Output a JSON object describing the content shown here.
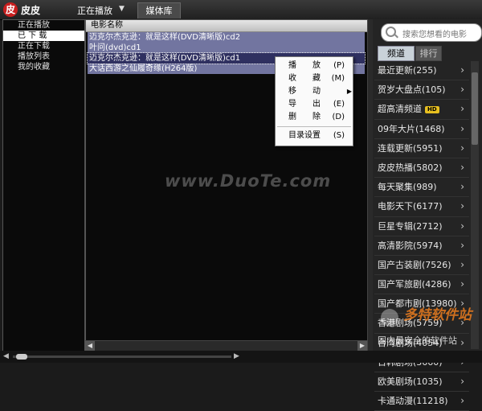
{
  "app": {
    "logo_glyph": "皮",
    "title": "皮皮"
  },
  "top_tabs": {
    "now_playing": "正在播放",
    "library": "媒体库"
  },
  "left_nav": {
    "items": [
      "正在播放",
      "已 下 载",
      "正在下载",
      "播放列表",
      "我的收藏"
    ],
    "selected_index": 1
  },
  "file_list": {
    "column_header": "电影名称",
    "rows": [
      {
        "name": "迈克尔杰克逊：就是这样(DVD清晰版)cd2",
        "state": "highlighted"
      },
      {
        "name": "叶问(dvd)cd1",
        "state": "highlighted"
      },
      {
        "name": "迈克尔杰克逊：就是这样(DVD清晰版)cd1",
        "state": "selected"
      },
      {
        "name": "大话西游之仙履奇缘(H264版)",
        "state": "highlighted"
      }
    ]
  },
  "context_menu": {
    "items": [
      {
        "label": "播　　放",
        "key": "(P)"
      },
      {
        "label": "收　　藏",
        "key": "(M)"
      },
      {
        "label": "移　　动",
        "key": ""
      },
      {
        "label": "导　　出",
        "key": "(E)"
      },
      {
        "label": "删　　除",
        "key": "(D)"
      },
      {
        "label": "目录设置",
        "key": "(S)"
      }
    ]
  },
  "watermark": "www.DuoTe.com",
  "search": {
    "placeholder": "搜索您想看的电影"
  },
  "right_tabs": {
    "channels": "频道",
    "ranking": "排行"
  },
  "channels": [
    {
      "label": "最近更新(255)"
    },
    {
      "label": "贺岁大盘点(105)"
    },
    {
      "label": "超高清频道",
      "badge": "HD"
    },
    {
      "label": "09年大片(1468)"
    },
    {
      "label": "连载更新(5951)"
    },
    {
      "label": "皮皮热播(5802)"
    },
    {
      "label": "每天聚集(989)"
    },
    {
      "label": "电影天下(6177)"
    },
    {
      "label": "巨星专辑(2712)"
    },
    {
      "label": "高清影院(5974)"
    },
    {
      "label": "国产古装剧(7526)"
    },
    {
      "label": "国产军旅剧(4286)"
    },
    {
      "label": "国产都市剧(13980)"
    },
    {
      "label": "香港剧场(5759)"
    },
    {
      "label": "台湾剧场(4054)"
    },
    {
      "label": "日韩剧场(3660)"
    },
    {
      "label": "欧美剧场(1035)"
    },
    {
      "label": "卡通动漫(11218)"
    }
  ],
  "site_brand": {
    "name": "多特软件站",
    "slogan": "国内最安全的软件站"
  },
  "colors": {
    "accent_red": "#c81e1e",
    "row_highlight": "#7275a0",
    "hd_badge": "#e8c020"
  }
}
